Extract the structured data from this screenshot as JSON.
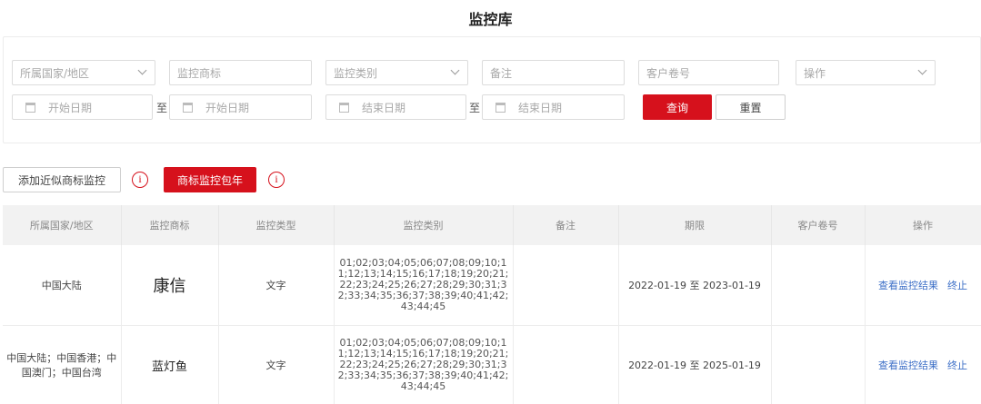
{
  "page": {
    "title": "监控库"
  },
  "filters": {
    "country_placeholder": "所属国家/地区",
    "mark_placeholder": "监控商标",
    "type_placeholder": "监控类别",
    "remark_placeholder": "备注",
    "customer_no_placeholder": "客户卷号",
    "operation_placeholder": "操作",
    "start_date_placeholder": "开始日期",
    "end_date_placeholder": "结束日期",
    "to_label": "至",
    "search_label": "查询",
    "reset_label": "重置"
  },
  "actions": {
    "add_similar_label": "添加近似商标监控",
    "package_label": "商标监控包年",
    "info_glyph": "i"
  },
  "table": {
    "headers": [
      "所属国家/地区",
      "监控商标",
      "监控类型",
      "监控类别",
      "备注",
      "期限",
      "客户卷号",
      "操作"
    ],
    "rows": [
      {
        "country": "中国大陆",
        "mark": "康信",
        "type": "文字",
        "classes": "01;02;03;04;05;06;07;08;09;10;11;12;13;14;15;16;17;18;19;20;21;22;23;24;25;26;27;28;29;30;31;32;33;34;35;36;37;38;39;40;41;42;43;44;45",
        "remark": "",
        "period": "2022-01-19 至 2023-01-19",
        "customer_no": "",
        "view_label": "查看监控结果",
        "stop_label": "终止"
      },
      {
        "country": "中国大陆；中国香港；中国澳门；中国台湾",
        "mark": "蓝灯鱼",
        "type": "文字",
        "classes": "01;02;03;04;05;06;07;08;09;10;11;12;13;14;15;16;17;18;19;20;21;22;23;24;25;26;27;28;29;30;31;32;33;34;35;36;37;38;39;40;41;42;43;44;45",
        "remark": "",
        "period": "2022-01-19 至 2025-01-19",
        "customer_no": "",
        "view_label": "查看监控结果",
        "stop_label": "终止"
      }
    ]
  },
  "colors": {
    "accent": "#d6111c",
    "link": "#3d6fc7",
    "header_bg": "#f2f2f2"
  },
  "icons": [
    "chevron-down-icon",
    "calendar-icon",
    "info-icon"
  ]
}
